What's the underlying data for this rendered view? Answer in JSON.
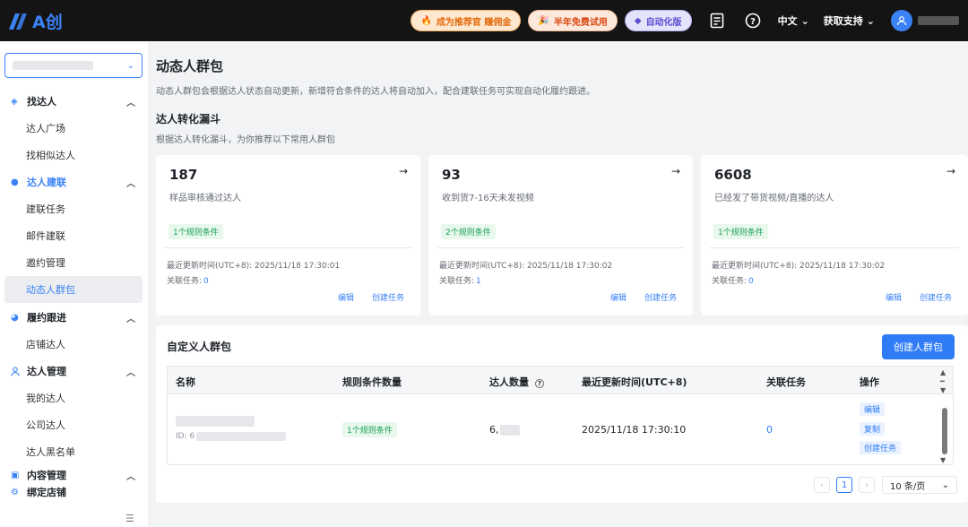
{
  "brand": {
    "logo_text": "A创",
    "accent": "#3b82f6"
  },
  "topbar": {
    "promo_referral": "成为推荐官 赚佣金",
    "promo_trial": "半年免费试用",
    "promo_automation": "自动化版",
    "doc_icon": "document-icon",
    "help_icon": "help-icon",
    "language": "中文",
    "support": "获取支持"
  },
  "sidebar": {
    "groups": [
      {
        "label": "找达人",
        "icon": "diamond-icon",
        "items": [
          "达人广场",
          "找相似达人"
        ]
      },
      {
        "label": "达人建联",
        "icon": "chat-icon",
        "items": [
          "建联任务",
          "邮件建联",
          "邀约管理",
          "动态人群包"
        ]
      },
      {
        "label": "履约跟进",
        "icon": "pie-icon",
        "items": [
          "店铺达人"
        ]
      },
      {
        "label": "达人管理",
        "icon": "user-icon",
        "items": [
          "我的达人",
          "公司达人",
          "达人黑名单"
        ]
      },
      {
        "label": "内容管理",
        "icon": "image-icon",
        "items": []
      },
      {
        "label": "绑定店铺",
        "icon": "settings-icon",
        "items": []
      }
    ]
  },
  "page": {
    "title": "动态人群包",
    "description": "动态人群包会根据达人状态自动更新，新增符合条件的达人将自动加入，配合建联任务可实现自动化履约跟进。",
    "funnel_title": "达人转化漏斗",
    "funnel_description": "根据达人转化漏斗，为你推荐以下常用人群包"
  },
  "cards": [
    {
      "count": "187",
      "label": "样品审核通过达人",
      "rules": "1个规则条件",
      "updated": "最近更新时间(UTC+8): 2025/11/18 17:30:01",
      "related_label": "关联任务:",
      "related_value": "0",
      "edit": "编辑",
      "create": "创建任务"
    },
    {
      "count": "93",
      "label": "收到货7-16天未发视频",
      "rules": "2个规则条件",
      "updated": "最近更新时间(UTC+8): 2025/11/18 17:30:02",
      "related_label": "关联任务:",
      "related_value": "1",
      "edit": "编辑",
      "create": "创建任务"
    },
    {
      "count": "6608",
      "label": "已经发了带货视频/直播的达人",
      "rules": "1个规则条件",
      "updated": "最近更新时间(UTC+8): 2025/11/18 17:30:02",
      "related_label": "关联任务:",
      "related_value": "0",
      "edit": "编辑",
      "create": "创建任务"
    }
  ],
  "custom": {
    "title": "自定义人群包",
    "create_button": "创建人群包",
    "columns": [
      "名称",
      "规则条件数量",
      "达人数量",
      "最近更新时间(UTC+8)",
      "关联任务",
      "操作"
    ],
    "rows": [
      {
        "id_prefix": "ID: 6",
        "rules": "1个规则条件",
        "count_prefix": "6,",
        "updated": "2025/11/18 17:30:10",
        "related": "0",
        "ops": [
          "编辑",
          "复制",
          "创建任务"
        ]
      }
    ]
  },
  "pagination": {
    "current": "1",
    "page_size": "10 条/页"
  }
}
